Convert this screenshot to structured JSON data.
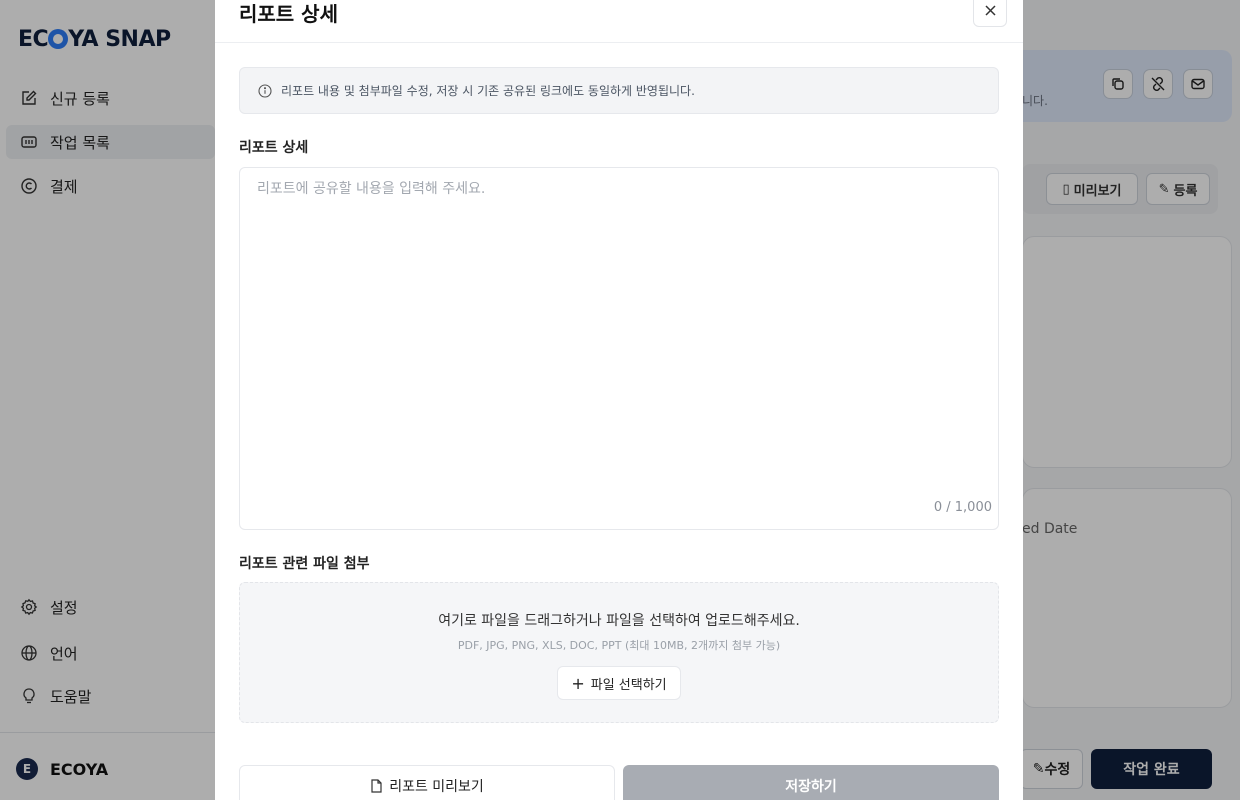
{
  "sidebar": {
    "logo": "ECOYA SNAP",
    "nav_items": [
      {
        "label": "신규 등록",
        "icon": "edit-icon"
      },
      {
        "label": "작업 목록",
        "icon": "list-icon"
      },
      {
        "label": "결제",
        "icon": "copyright-icon"
      }
    ],
    "bottom_items": [
      {
        "label": "설정",
        "icon": "gear-icon"
      },
      {
        "label": "언어",
        "icon": "globe-icon"
      },
      {
        "label": "도움말",
        "icon": "lightbulb-icon"
      }
    ],
    "account": {
      "initial": "E",
      "name": "ECOYA"
    }
  },
  "background": {
    "info_strip_text": "니다.",
    "preview_label": "미리보기",
    "register_label": "등록",
    "card_text": "ed Date",
    "edit_label": "수정",
    "complete_label": "작업 완료"
  },
  "modal": {
    "title": "리포트 상세",
    "notice": "리포트 내용 및 첨부파일 수정, 저장 시 기존 공유된 링크에도 동일하게 반영됩니다.",
    "detail_label": "리포트 상세",
    "textarea": {
      "placeholder": "리포트에 공유할 내용을 입력해 주세요.",
      "value": "",
      "counter": "0 / 1,000"
    },
    "attach_label": "리포트 관련 파일 첨부",
    "dropzone": {
      "main_text": "여기로 파일을 드래그하거나 파일을 선택하여 업로드해주세요.",
      "sub_text": "PDF, JPG, PNG, XLS, DOC, PPT (최대 10MB, 2개까지 첨부 가능)",
      "button_label": "파일 선택하기",
      "button_prefix": "+"
    },
    "preview_button": "리포트 미리보기",
    "save_button": "저장하기"
  },
  "colors": {
    "brand_navy": "#0f1f3d",
    "brand_blue": "#2d7df6",
    "save_disabled": "#a8acb3"
  }
}
